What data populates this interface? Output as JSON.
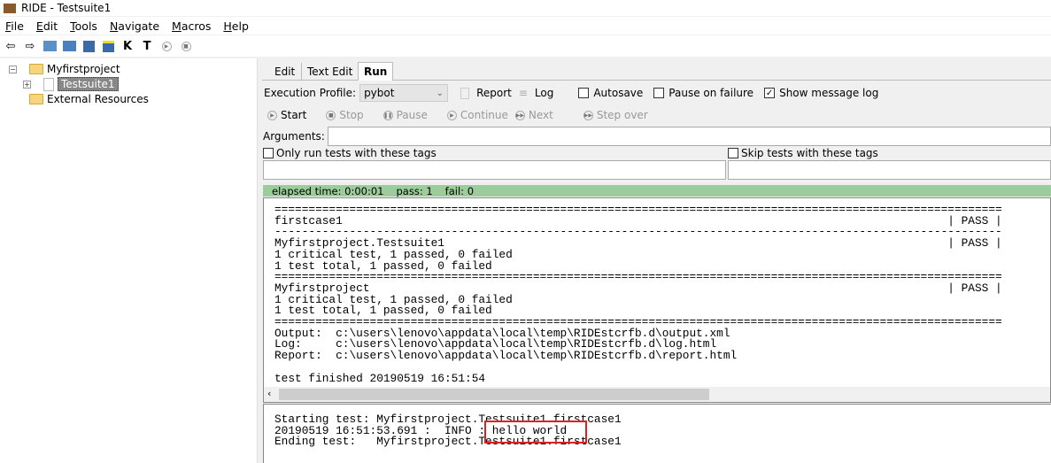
{
  "window": {
    "title": "RIDE - Testsuite1"
  },
  "menu": [
    "File",
    "Edit",
    "Tools",
    "Navigate",
    "Macros",
    "Help"
  ],
  "toolbar": {
    "icons": [
      "back-arrow-icon",
      "forward-arrow-icon",
      "open-project-icon",
      "open-folder-icon",
      "save-icon",
      "save-all-icon",
      "keyword-search-icon",
      "test-search-icon",
      "run-icon",
      "stop-icon"
    ],
    "k": "K",
    "t": "T"
  },
  "tree": {
    "project": "Myfirstproject",
    "suite": "Testsuite1",
    "external": "External Resources"
  },
  "tabs": [
    "Edit",
    "Text Edit",
    "Run"
  ],
  "run": {
    "profile_label": "Execution Profile:",
    "profile_value": "pybot",
    "report": "Report",
    "log": "Log",
    "autosave": "Autosave",
    "pause_on_failure": "Pause on failure",
    "show_message_log": "Show message log",
    "autosave_checked": false,
    "pause_checked": false,
    "show_log_checked": true,
    "buttons": [
      "Start",
      "Stop",
      "Pause",
      "Continue",
      "Next",
      "Step over"
    ],
    "arguments_label": "Arguments:",
    "arguments_value": "",
    "only_run_tags": "Only run tests with these tags",
    "skip_tags": "Skip tests with these tags",
    "status": {
      "elapsed": "elapsed time: 0:00:01",
      "pass": "pass: 1",
      "fail": "fail: 0",
      "color": "#9ccc9c"
    },
    "output": "===========================================================================================================\nfirstcase1                                                                                         | PASS |\n-----------------------------------------------------------------------------------------------------------\nMyfirstproject.Testsuite1                                                                          | PASS |\n1 critical test, 1 passed, 0 failed\n1 test total, 1 passed, 0 failed\n===========================================================================================================\nMyfirstproject                                                                                     | PASS |\n1 critical test, 1 passed, 0 failed\n1 test total, 1 passed, 0 failed\n===========================================================================================================\nOutput:  c:\\users\\lenovo\\appdata\\local\\temp\\RIDEstcrfb.d\\output.xml\nLog:     c:\\users\\lenovo\\appdata\\local\\temp\\RIDEstcrfb.d\\log.html\nReport:  c:\\users\\lenovo\\appdata\\local\\temp\\RIDEstcrfb.d\\report.html\n\ntest finished 20190519 16:51:54",
    "message_log": "Starting test: Myfirstproject.Testsuite1.firstcase1\n20190519 16:51:53.691 :  INFO : hello world\nEnding test:   Myfirstproject.Testsuite1.firstcase1",
    "highlight_color": "#e02020"
  }
}
